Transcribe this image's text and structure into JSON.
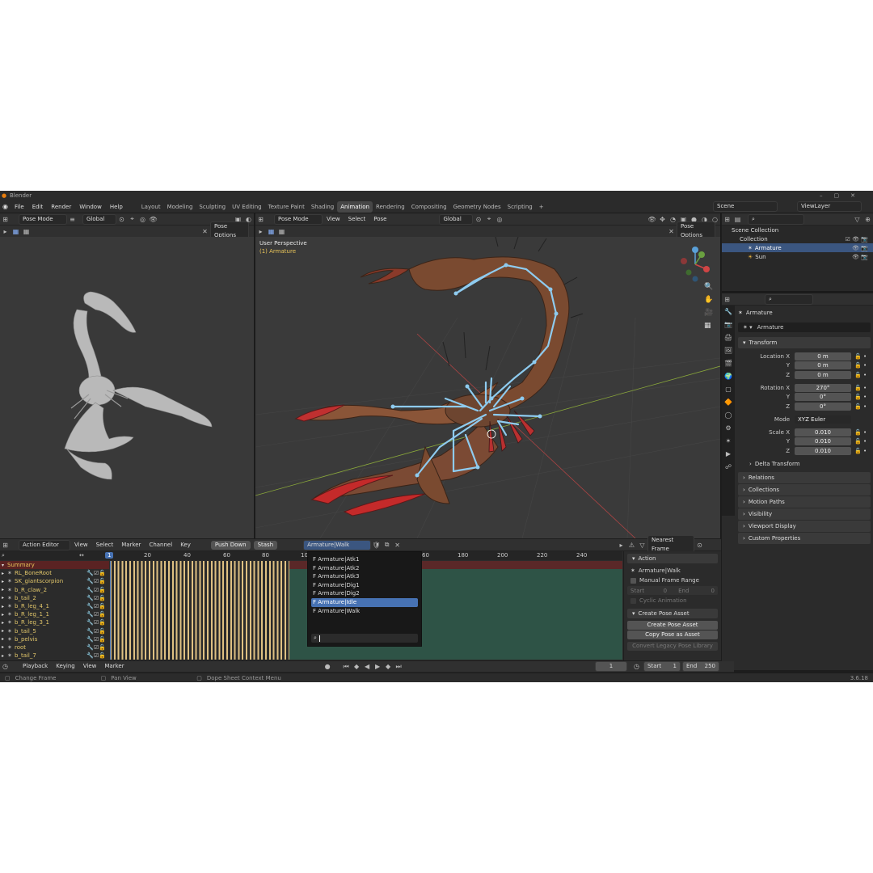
{
  "window_title": "Blender",
  "menu": [
    "File",
    "Edit",
    "Render",
    "Window",
    "Help"
  ],
  "workspaces": [
    "Layout",
    "Modeling",
    "Sculpting",
    "UV Editing",
    "Texture Paint",
    "Shading",
    "Animation",
    "Rendering",
    "Compositing",
    "Geometry Nodes",
    "Scripting"
  ],
  "active_workspace": "Animation",
  "scene": "Scene",
  "view_layer": "ViewLayer",
  "left_viewport": {
    "mode": "Pose Mode",
    "orientation": "Global",
    "pose_options": "Pose Options"
  },
  "right_viewport": {
    "mode": "Pose Mode",
    "menus": [
      "View",
      "Select",
      "Pose"
    ],
    "orientation": "Global",
    "pose_options": "Pose Options",
    "overlay_title": "User Perspective",
    "overlay_sub": "(1) Armature"
  },
  "outliner": {
    "title": "Scene Collection",
    "collection": "Collection",
    "items": [
      "Armature",
      "Sun"
    ]
  },
  "properties": {
    "object": "Armature",
    "data_name": "Armature",
    "transform": "Transform",
    "location": {
      "label": "Location X",
      "x": "0 m",
      "y": "0 m",
      "z": "0 m"
    },
    "rotation": {
      "label": "Rotation X",
      "x": "270°",
      "y": "0°",
      "z": "0°"
    },
    "mode": {
      "label": "Mode",
      "value": "XYZ Euler"
    },
    "scale": {
      "label": "Scale X",
      "x": "0.010",
      "y": "0.010",
      "z": "0.010"
    },
    "axis_y": "Y",
    "axis_z": "Z",
    "delta": "Delta Transform",
    "sections": [
      "Relations",
      "Collections",
      "Motion Paths",
      "Visibility",
      "Viewport Display",
      "Custom Properties"
    ]
  },
  "dope": {
    "editor": "Action Editor",
    "menus": [
      "View",
      "Select",
      "Marker",
      "Channel",
      "Key"
    ],
    "push_down": "Push Down",
    "stash": "Stash",
    "action": "Armature|Walk",
    "snap": "Nearest Frame",
    "ruler": [
      "20",
      "40",
      "60",
      "80",
      "10"
    ],
    "ruler_right": [
      "60",
      "180",
      "200",
      "220",
      "240"
    ],
    "current_frame_marker": "1",
    "summary": "Summary",
    "channels": [
      "RL_BoneRoot",
      "SK_giantscorpion",
      "b_R_claw_2",
      "b_tail_2",
      "b_R_leg_4_1",
      "b_R_leg_1_1",
      "b_R_leg_3_1",
      "b_tail_5",
      "b_pelvis",
      "root",
      "b_tail_7"
    ],
    "action_list": [
      "F Armature|Atk1",
      "F Armature|Atk2",
      "F Armature|Atk3",
      "F Armature|Dig1",
      "F Armature|Dig2",
      "F Armature|Idle",
      "F Armature|Walk"
    ],
    "selected_action": "F Armature|Idle",
    "side": {
      "action_h": "Action",
      "action_name": "Armature|Walk",
      "manual": "Manual Frame Range",
      "start": "Start",
      "start_v": "0",
      "end": "End",
      "end_v": "0",
      "cyclic": "Cyclic Animation",
      "pose_h": "Create Pose Asset",
      "create": "Create Pose Asset",
      "copy": "Copy Pose as Asset",
      "convert": "Convert Legacy Pose Library"
    }
  },
  "timeline": {
    "menus": [
      "Playback",
      "Keying",
      "View",
      "Marker"
    ],
    "frame": "1",
    "start_label": "Start",
    "start": "1",
    "end_label": "End",
    "end": "250"
  },
  "status": {
    "left": "Change Frame",
    "mid": "Pan View",
    "right": "Dope Sheet Context Menu",
    "version": "3.6.18"
  }
}
